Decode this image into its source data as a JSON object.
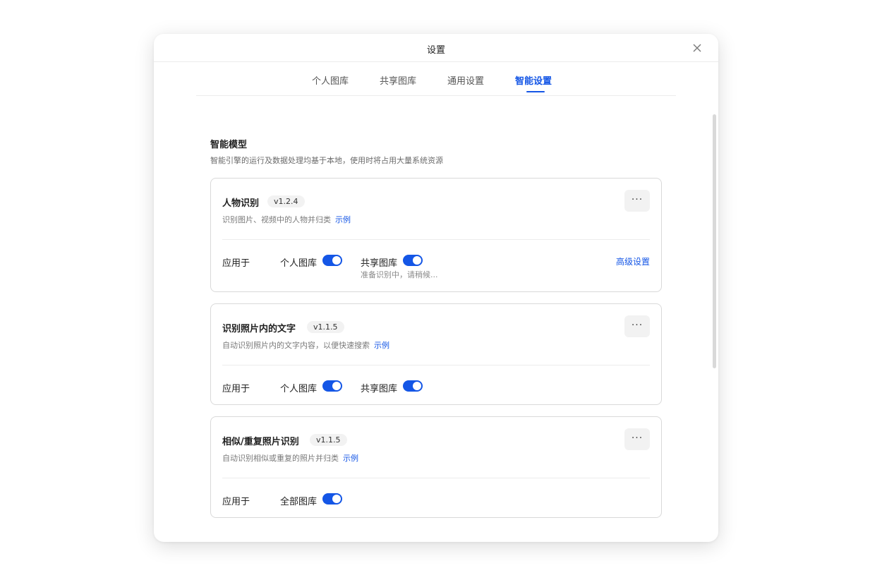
{
  "dialog": {
    "title": "设置",
    "close_icon": "close-icon"
  },
  "tabs": [
    {
      "label": "个人图库",
      "active": false
    },
    {
      "label": "共享图库",
      "active": false
    },
    {
      "label": "通用设置",
      "active": false
    },
    {
      "label": "智能设置",
      "active": true
    }
  ],
  "section": {
    "title": "智能模型",
    "description": "智能引擎的运行及数据处理均基于本地，使用时将占用大量系统资源"
  },
  "colors": {
    "accent": "#1456e6"
  },
  "models": [
    {
      "name": "人物识别",
      "version": "v1.2.4",
      "description": "识别图片、视频中的人物并归类",
      "example_label": "示例",
      "apply_label": "应用于",
      "libraries": [
        {
          "label": "个人图库",
          "enabled": true
        },
        {
          "label": "共享图库",
          "enabled": true,
          "status": "准备识别中，请稍候..."
        }
      ],
      "advanced_label": "高级设置"
    },
    {
      "name": "识别照片内的文字",
      "version": "v1.1.5",
      "description": "自动识别照片内的文字内容，以便快速搜索",
      "example_label": "示例",
      "apply_label": "应用于",
      "libraries": [
        {
          "label": "个人图库",
          "enabled": true
        },
        {
          "label": "共享图库",
          "enabled": true
        }
      ]
    },
    {
      "name": "相似/重复照片识别",
      "version": "v1.1.5",
      "description": "自动识别相似或重复的照片并归类",
      "example_label": "示例",
      "apply_label": "应用于",
      "libraries": [
        {
          "label": "全部图库",
          "enabled": true
        }
      ]
    }
  ],
  "more_button": {
    "label": "···",
    "icon": "more-icon"
  }
}
